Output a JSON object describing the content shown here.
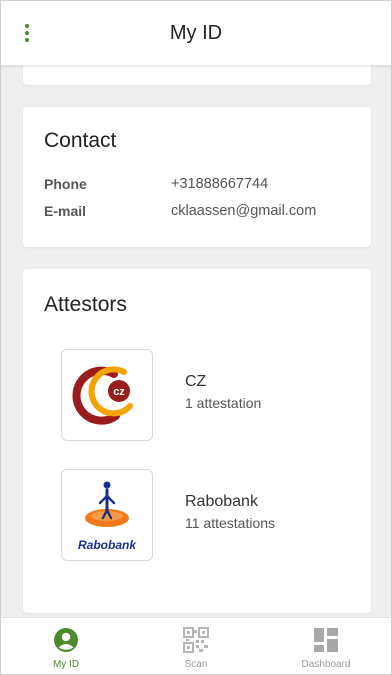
{
  "header": {
    "title": "My ID",
    "menu_icon": "overflow-menu-icon"
  },
  "contact": {
    "title": "Contact",
    "rows": [
      {
        "label": "Phone",
        "value": "+31888667744"
      },
      {
        "label": "E-mail",
        "value": "cklaassen@gmail.com"
      }
    ]
  },
  "attestors": {
    "title": "Attestors",
    "items": [
      {
        "name": "CZ",
        "count": "1 attestation",
        "logo": "cz-logo"
      },
      {
        "name": "Rabobank",
        "count": "11 attestations",
        "logo": "rabobank-logo",
        "logo_text": "Rabobank"
      }
    ]
  },
  "nav": {
    "items": [
      {
        "label": "My ID",
        "icon": "profile-icon",
        "active": true
      },
      {
        "label": "Scan",
        "icon": "qr-code-icon",
        "active": false
      },
      {
        "label": "Dashboard",
        "icon": "dashboard-icon",
        "active": false
      }
    ]
  },
  "colors": {
    "accent": "#4c8a2c",
    "background": "#efefef",
    "cz_red": "#9b1c1c",
    "cz_orange": "#f5a300",
    "rabobank_orange": "#f07a1a",
    "rabobank_blue": "#1a2e8c"
  }
}
